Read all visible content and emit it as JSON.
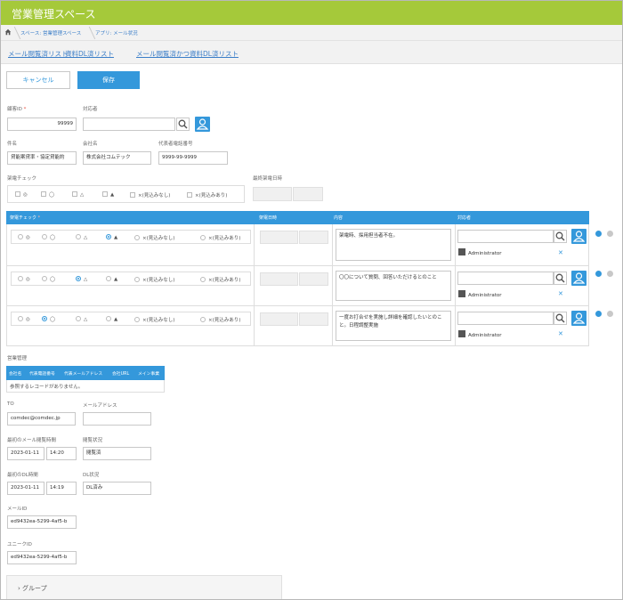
{
  "header": {
    "title": "営業管理スペース"
  },
  "breadcrumb": {
    "items": [
      "スペース: 営業管理スペース",
      "アプリ: メール状況"
    ]
  },
  "view_tabs": [
    "メール閲覧済リスト",
    "資料DL済リスト",
    "メール閲覧済かつ資料DL済リスト"
  ],
  "actions": {
    "cancel": "キャンセル",
    "save": "保存"
  },
  "fields": {
    "customer_id": {
      "label": "顧客ID",
      "required_mark": "*",
      "value": "99999"
    },
    "assignee": {
      "label": "対応者",
      "value": ""
    },
    "subject": {
      "label": "件名",
      "value": "貸能案貸率・協定貸能約"
    },
    "company": {
      "label": "会社名",
      "value": "株式会社コムテック"
    },
    "phone": {
      "label": "代表者電話番号",
      "value": "9999-99-9999"
    },
    "call_check": {
      "label": "架電チェック",
      "options": [
        "◎",
        "◯",
        "△",
        "▲",
        "×(見込みなし)",
        "×(見込みあり)"
      ]
    },
    "last_call": {
      "label": "最終架電日時",
      "date": "",
      "time": ""
    }
  },
  "subtable": {
    "headers": {
      "check": "架電チェック",
      "required_mark": "*",
      "datetime": "架電日時",
      "content": "内容",
      "responder": "対応者"
    },
    "options": [
      "◎",
      "◯",
      "△",
      "▲",
      "×(見込みなし)",
      "×(見込みあり)"
    ],
    "rows": [
      {
        "selected": 3,
        "content": "架電時、採用担当者不在。",
        "user": "Administrator"
      },
      {
        "selected": 2,
        "content": "〇〇について質問、回答いただけるとのこと",
        "user": "Administrator"
      },
      {
        "selected": 1,
        "content": "一度お打合せを実施し詳細を確認したいとのこと。日程調整実施",
        "user": "Administrator"
      }
    ]
  },
  "ref_table": {
    "label": "営業管理",
    "headers": [
      "会社名",
      "代表電話番号",
      "代表メールアドレス",
      "会社URL",
      "メイン事業"
    ],
    "empty_text": "参照するレコードがありません。"
  },
  "fields2": {
    "to": {
      "label": "TO",
      "value": "comdec@comdec.jp"
    },
    "mail": {
      "label": "メールアドレス",
      "value": ""
    },
    "first_open": {
      "label": "最初のメール閲覧時間",
      "date": "2023-01-11",
      "time": "14:20"
    },
    "open_status": {
      "label": "閲覧状況",
      "value": "閲覧済"
    },
    "first_dl": {
      "label": "最初のDL時間",
      "date": "2023-01-11",
      "time": "14:19"
    },
    "dl_status": {
      "label": "DL状況",
      "value": "DL済み"
    },
    "mail_id": {
      "label": "メールID",
      "value": "ed9432ea-5299-4af5-b"
    },
    "unique_id": {
      "label": "ユニークID",
      "value": "ed9432ea-5299-4af5-b"
    }
  },
  "group": {
    "label": "グループ"
  },
  "colors": {
    "header": "#a5c93a",
    "accent": "#3498db",
    "required": "#e74c3c"
  }
}
